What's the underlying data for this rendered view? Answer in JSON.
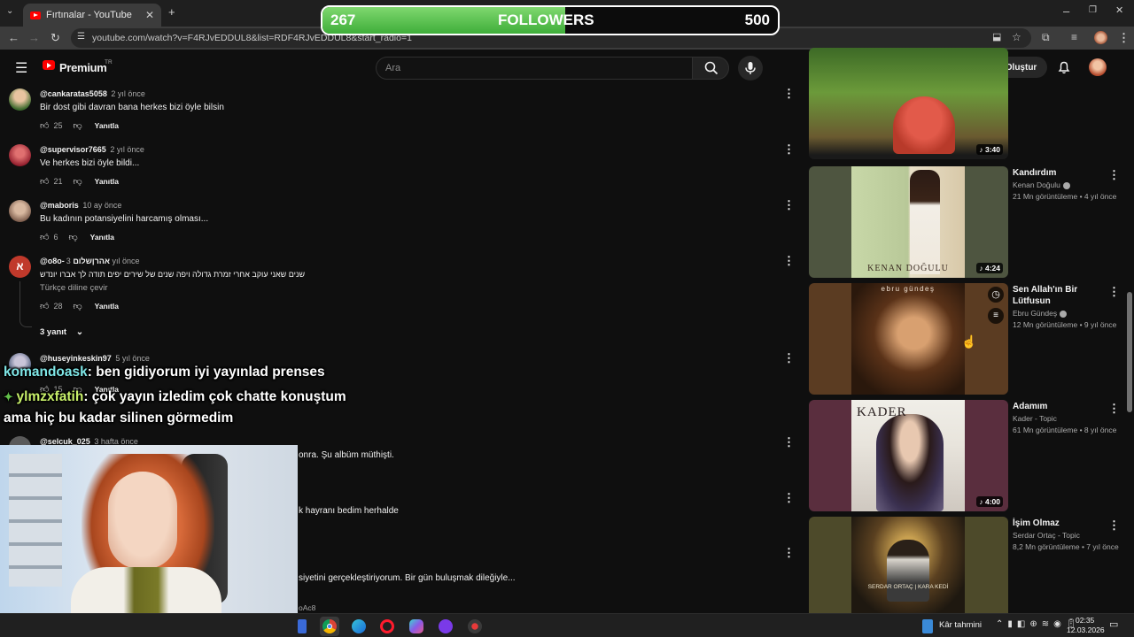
{
  "browser": {
    "tab_title": "Fırtınalar - YouTube",
    "url": "youtube.com/watch?v=F4RJvEDDUL8&list=RDF4RJvEDDUL8&start_radio=1",
    "new_tab": "+",
    "close": "✕"
  },
  "follower_goal": {
    "current": "267",
    "label": "FOLLOWERS",
    "target": "500",
    "progress": 0.534
  },
  "masthead": {
    "logo_text": "Premium",
    "logo_badge": "TR",
    "search_placeholder": "Ara",
    "create_label": "Oluştur"
  },
  "comments": [
    {
      "user": "@cankaratas5058",
      "time": "2 yıl önce",
      "text": "Bir dost gibi davran bana herkes bizi öyle bilsin",
      "likes": "25",
      "reply": "Yanıtla",
      "avatar_color": "#4a7a3a"
    },
    {
      "user": "@supervisor7665",
      "time": "2 yıl önce",
      "text": "Ve herkes bizi öyle bildi...",
      "likes": "21",
      "reply": "Yanıtla",
      "avatar_color": "#b02a3a"
    },
    {
      "user": "@maboris",
      "time": "10 ay önce",
      "text": "Bu kadının potansiyelini harcamış olması...",
      "likes": "6",
      "reply": "Yanıtla",
      "avatar_color": "#8a6a5a"
    },
    {
      "user": "@o8o-אהרןשלום",
      "time": "3 yıl önce",
      "text": "שנים שאני עוקב אחרי זמרת גדולה ויפה שנים של שירים יפים תודה לך אברו יונדש",
      "translate": "Türkçe diline çevir",
      "likes": "28",
      "reply": "Yanıtla",
      "avatar_letter": "א",
      "avatar_color": "#c0392b"
    },
    {
      "user": "@huseyinkeskin97",
      "time": "5 yıl önce",
      "likes": "15",
      "reply": "Yanıtla",
      "avatar_color": "#5a6a8a"
    },
    {
      "user": "@selcuk_025",
      "time": "3 hafta önce",
      "avatar_color": "#6a6a6a"
    }
  ],
  "replies_toggle": "3 yanıt",
  "partial_texts": [
    "onra. Şu albüm müthişti.",
    "k hayranı bedim herhalde",
    "siyetini gerçekleştiriyorum. Bir gün buluşmak dileğiyle...",
    "oAc8"
  ],
  "chat": [
    {
      "user": "komandoask",
      "message": ": ben gidiyorum iyi yayınlad prenses"
    },
    {
      "user": "ylmzxfatih",
      "message": ": çok yayın izledim çok chatte konuştum"
    },
    {
      "user": "",
      "message": "ama hiç bu kadar silinen görmedim"
    }
  ],
  "sidebar_videos": [
    {
      "title": "",
      "channel": "",
      "meta": "",
      "duration": "3:40",
      "bg": "#4d7a2e"
    },
    {
      "title": "Kandırdım",
      "channel": "Kenan Doğulu",
      "meta": "21 Mn görüntüleme • 4 yıl önce",
      "duration": "4:24",
      "bg": "#4e5540",
      "art_text": "KENAN DOĞULU"
    },
    {
      "title": "Sen Allah'ın Bir Lütfusun",
      "channel": "Ebru Gündeş",
      "meta": "12 Mn görüntüleme • 9 yıl önce",
      "duration": "",
      "bg": "#5b3c22",
      "art_text": "ebru gündeş"
    },
    {
      "title": "Adamım",
      "channel": "Kader - Topic",
      "meta": "61 Mn görüntüleme • 8 yıl önce",
      "duration": "4:00",
      "bg": "#5a2e3e",
      "art_text": "KADER"
    },
    {
      "title": "İşim Olmaz",
      "channel": "Serdar Ortaç - Topic",
      "meta": "8,2 Mn görüntüleme • 7 yıl önce",
      "duration": "",
      "bg": "#4d4a2a",
      "art_text": "SERDAR ORTAÇ | KARA KEDİ"
    }
  ],
  "taskbar": {
    "weather": "Kâr tahmini",
    "time": "02:35",
    "date": "12.03.2026"
  }
}
